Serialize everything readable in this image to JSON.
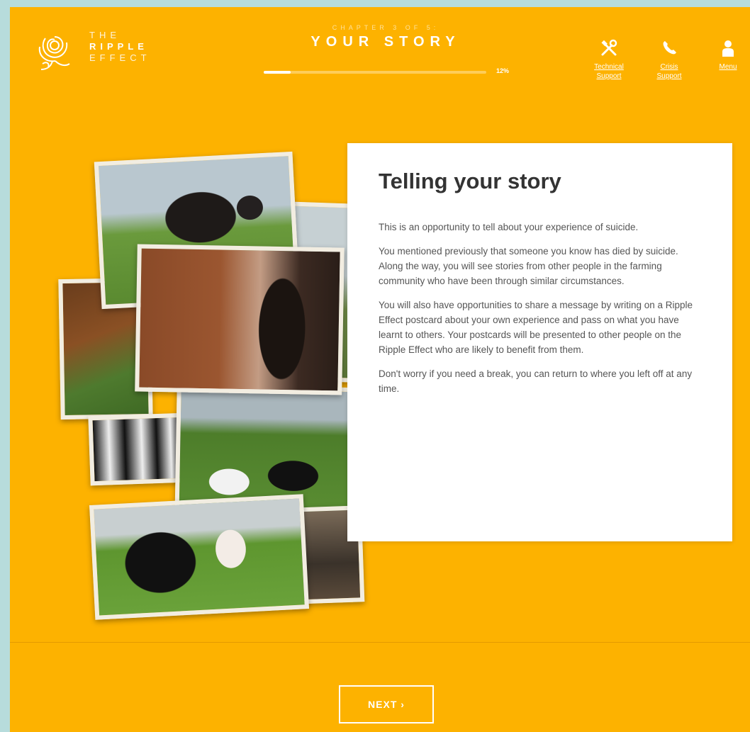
{
  "header": {
    "logo": {
      "line1": "THE",
      "line2": "RIPPLE",
      "line3": "EFFECT"
    },
    "chapter_label": "CHAPTER 3 OF 5:",
    "chapter_title": "YOUR STORY",
    "progress": {
      "value": 0.12,
      "label": "12%"
    },
    "buttons": [
      {
        "icon": "tools-icon",
        "label": "Technical Support"
      },
      {
        "icon": "phone-icon",
        "label": "Crisis Support"
      },
      {
        "icon": "person-icon",
        "label": "Menu"
      }
    ]
  },
  "card": {
    "title": "Telling your story",
    "paragraphs": [
      "This is an opportunity to tell about your experience of suicide.",
      "You mentioned previously that someone you know has died by suicide. Along the way, you will see stories from other people in the farming community who have been through similar circumstances.",
      "You will also have opportunities to share a message by writing on a Ripple Effect postcard about your own experience and pass on what you have learnt to others. Your postcards will be presented to other people on the Ripple Effect who are likely to benefit from them.",
      "Don't worry if you need a break, you can return to where you left off at any time."
    ]
  },
  "footer": {
    "next_label": "NEXT ›"
  },
  "colors": {
    "background": "#fdb200",
    "card": "#ffffff",
    "accent_text": "#333333"
  }
}
